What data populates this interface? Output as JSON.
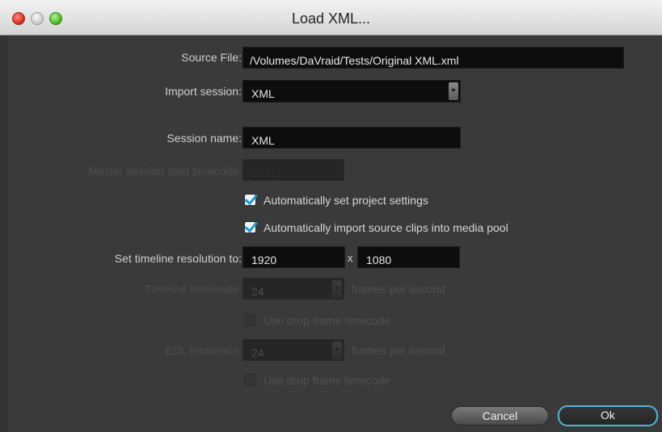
{
  "window": {
    "title": "Load XML..."
  },
  "form": {
    "source_file": {
      "label": "Source File:",
      "value": "/Volumes/DaVraid/Tests/Original XML.xml"
    },
    "import_session": {
      "label": "Import session:",
      "value": "XML"
    },
    "session_name": {
      "label": "Session name:",
      "value": "XML"
    },
    "master_timecode": {
      "label": "Master session start timecode:",
      "value": ": : :",
      "enabled": false
    },
    "auto_project_settings": {
      "label": "Automatically set project settings",
      "checked": true
    },
    "auto_import_clips": {
      "label": "Automatically import source clips into media pool",
      "checked": true
    },
    "timeline_resolution": {
      "label": "Set timeline resolution to:",
      "width": "1920",
      "separator": "x",
      "height": "1080"
    },
    "timeline_framerate": {
      "label": "Timeline framerate:",
      "value": "24",
      "unit": "frames per second",
      "enabled": false
    },
    "timeline_drop_frame": {
      "label": "Use drop frame timecode",
      "checked": false,
      "enabled": false
    },
    "edl_framerate": {
      "label": "EDL framerate:",
      "value": "24",
      "unit": "frames per second",
      "enabled": false
    },
    "edl_drop_frame": {
      "label": "Use drop frame timecode",
      "checked": false,
      "enabled": false
    }
  },
  "buttons": {
    "cancel": "Cancel",
    "ok": "Ok"
  },
  "icons": {
    "close": "close-light-icon",
    "minimize": "minimize-light-icon",
    "zoom": "zoom-light-icon",
    "checkmark": "checkmark-icon",
    "dropdown": "chevron-down-icon"
  },
  "colors": {
    "panel": "#3a3a3a",
    "field": "#0d0d0d",
    "ok_accent": "#4fb6d8",
    "check_accent": "#1a9bd7"
  }
}
